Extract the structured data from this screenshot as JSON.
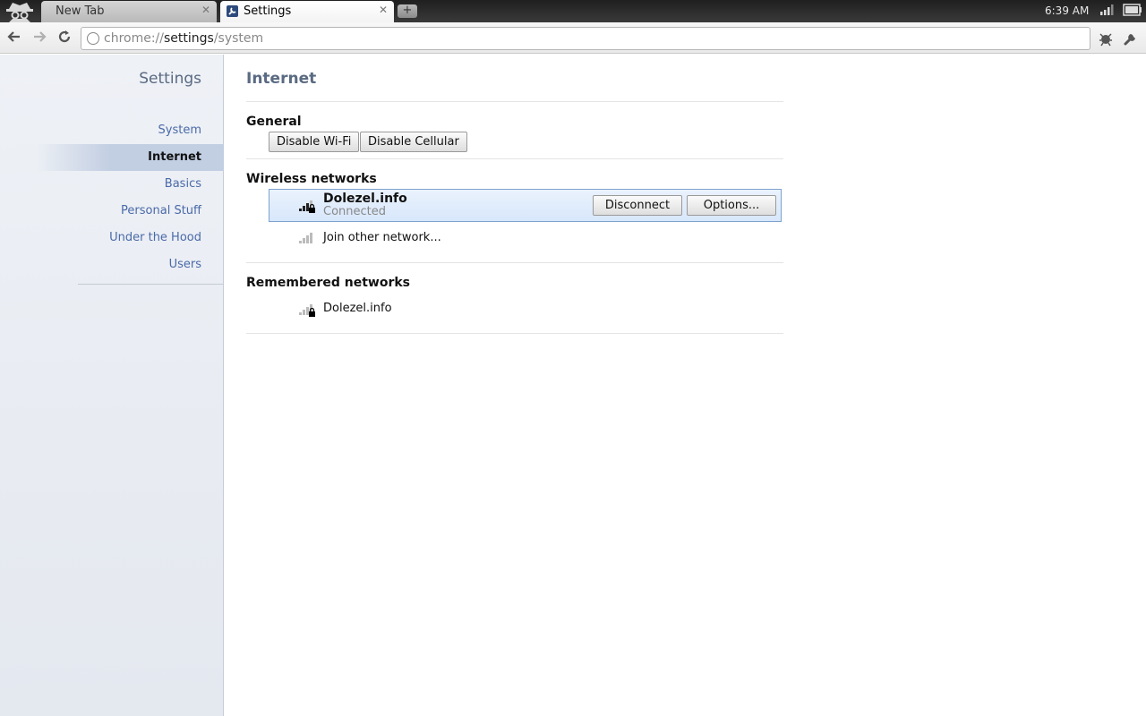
{
  "tabs": [
    {
      "title": "New Tab",
      "active": false
    },
    {
      "title": "Settings",
      "active": true
    }
  ],
  "clock": "6:39 AM",
  "toolbar": {
    "url_scheme": "chrome://",
    "url_host": "settings",
    "url_path": "/system"
  },
  "sidebar": {
    "title": "Settings",
    "items": [
      {
        "label": "System"
      },
      {
        "label": "Internet",
        "selected": true
      },
      {
        "label": "Basics"
      },
      {
        "label": "Personal Stuff"
      },
      {
        "label": "Under the Hood"
      },
      {
        "label": "Users"
      }
    ]
  },
  "main": {
    "title": "Internet",
    "general": {
      "title": "General",
      "disable_wifi": "Disable Wi-Fi",
      "disable_cellular": "Disable Cellular"
    },
    "wireless": {
      "title": "Wireless networks",
      "connected_network": {
        "name": "Dolezel.info",
        "status": "Connected",
        "disconnect_label": "Disconnect",
        "options_label": "Options..."
      },
      "join_other": "Join other network..."
    },
    "remembered": {
      "title": "Remembered networks",
      "networks": [
        {
          "name": "Dolezel.info"
        }
      ]
    }
  },
  "colors": {
    "accent_link": "#4a6aa8",
    "title": "#5a6a82",
    "selected_row_border": "#7da2ce"
  },
  "icons": [
    "incognito-icon",
    "settings-favicon",
    "close-icon",
    "new-tab-icon",
    "back-icon",
    "forward-icon",
    "reload-icon",
    "globe-icon",
    "extension-icon",
    "wrench-icon",
    "wifi-signal-icon",
    "lock-icon",
    "battery-icon"
  ]
}
